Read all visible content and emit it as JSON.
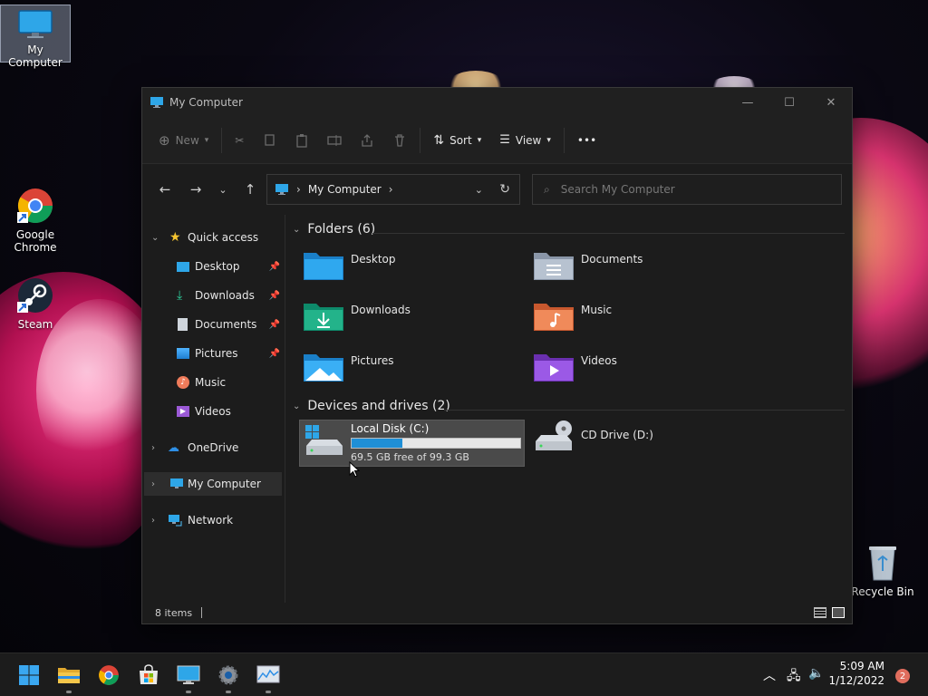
{
  "desktop": {
    "icons": [
      {
        "label": "My Computer"
      },
      {
        "label": "Google Chrome"
      },
      {
        "label": "Steam"
      },
      {
        "label": "Recycle Bin"
      }
    ]
  },
  "window": {
    "title": "My Computer",
    "toolbar": {
      "new_label": "New",
      "sort_label": "Sort",
      "view_label": "View",
      "more_label": "•••"
    },
    "address": {
      "path_label": "My Computer",
      "search_placeholder": "Search My Computer"
    },
    "sidebar": {
      "quick_access": "Quick access",
      "items": [
        {
          "label": "Desktop",
          "pinned": true
        },
        {
          "label": "Downloads",
          "pinned": true
        },
        {
          "label": "Documents",
          "pinned": true
        },
        {
          "label": "Pictures",
          "pinned": true
        },
        {
          "label": "Music",
          "pinned": false
        },
        {
          "label": "Videos",
          "pinned": false
        }
      ],
      "onedrive": "OneDrive",
      "my_computer": "My Computer",
      "network": "Network"
    },
    "content": {
      "folders_header": "Folders (6)",
      "folders": [
        {
          "label": "Desktop"
        },
        {
          "label": "Documents"
        },
        {
          "label": "Downloads"
        },
        {
          "label": "Music"
        },
        {
          "label": "Pictures"
        },
        {
          "label": "Videos"
        }
      ],
      "drives_header": "Devices and drives (2)",
      "drives": [
        {
          "label": "Local Disk (C:)",
          "free_text": "69.5 GB free of 99.3 GB",
          "used_fraction": 0.3
        },
        {
          "label": "CD Drive (D:)"
        }
      ]
    },
    "status": {
      "items_count": "8 items"
    }
  },
  "taskbar": {
    "time": "5:09 AM",
    "date": "1/12/2022",
    "notification_count": "2"
  },
  "colors": {
    "accent": "#1f8fd6",
    "window_bg": "#1c1c1c",
    "taskbar_bg": "#1c1c1c"
  }
}
